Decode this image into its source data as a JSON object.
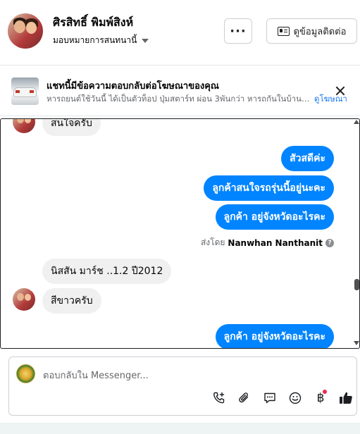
{
  "header": {
    "name": "ศิรสิทธิ์ พิมพ์สิงห์",
    "subtitle": "มอบหมายการสนทนานี้",
    "more_label": "···",
    "contact_label": "ดูข้อมูลติดต่อ"
  },
  "ad": {
    "title": "แชทนี้มีข้อความตอบกลับต่อโฆษณาของคุณ",
    "description": "หารถยนต์ใช้วันนี้ ได้เป็นตัวท็อป ปุ่มสตาร์ท ผ่อน 3พันกว่า หารถกันในบ้านสบา...",
    "link": "ดูโฆษณา"
  },
  "thread": {
    "messages": [
      {
        "side": "in",
        "text": "สนใจครับ"
      },
      {
        "side": "out",
        "text": "สัวสดีค่ะ"
      },
      {
        "side": "out",
        "text": "ลูกค้าสนใจรถรุ่นนี้อยู่นะคะ"
      },
      {
        "side": "out",
        "text": "ลูกค้า   อยู่จังหวัดอะไรคะ"
      },
      {
        "side": "in",
        "text": "นิสสัน มาร์ช ..1.2 ปี2012"
      },
      {
        "side": "in",
        "text": "สีขาวครับ"
      },
      {
        "side": "out",
        "text": "ลูกค้า   อยู่จังหวัดอะไรคะ"
      }
    ],
    "sent_by_prefix": "ส่งโดย",
    "sent_by_name": "Nanwhan Nanthanit",
    "help_glyph": "?"
  },
  "composer": {
    "placeholder": "ตอบกลับใน Messenger...",
    "tools": [
      "phone-plus-icon",
      "paperclip-icon",
      "quick-reply-icon",
      "emoji-icon",
      "baht-icon",
      "thumbs-up-icon"
    ],
    "baht_glyph": "฿",
    "accent": "#0084ff"
  }
}
